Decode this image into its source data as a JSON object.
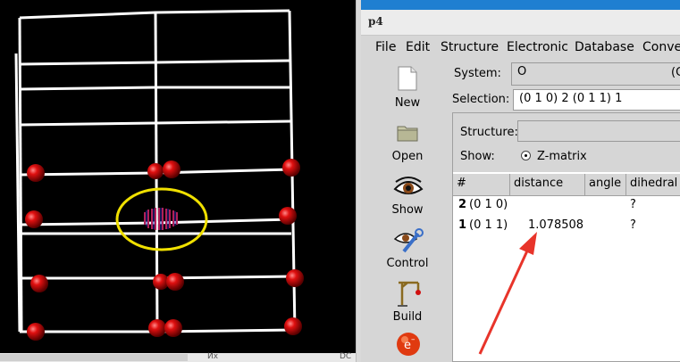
{
  "app": {
    "title_icon": "p4",
    "menus": [
      "File",
      "Edit",
      "Structure",
      "Electronic",
      "Database",
      "Conve"
    ]
  },
  "toolbar": {
    "items": [
      {
        "label": "New",
        "icon": "new-document-icon"
      },
      {
        "label": "Open",
        "icon": "folder-icon"
      },
      {
        "label": "Show",
        "icon": "eye-icon"
      },
      {
        "label": "Control",
        "icon": "wrench-eye-icon"
      },
      {
        "label": "Build",
        "icon": "crane-icon"
      },
      {
        "label": "",
        "icon": "electron-icon",
        "glyph": "e"
      }
    ]
  },
  "main": {
    "system_label": "System:",
    "system_value": "O",
    "system_suffix": "(C",
    "selection_label": "Selection:",
    "selection_value": "(0 1 0) 2  (0 1 1) 1",
    "structure_label": "Structure:",
    "structure_value": "",
    "show_label": "Show:",
    "show_option": "Z-matrix",
    "table": {
      "headers": [
        "#",
        "distance",
        "angle",
        "dihedral"
      ],
      "rows": [
        {
          "index": "2",
          "coords": "(0 1 0)",
          "distance": "",
          "angle": "",
          "dihedral": "?"
        },
        {
          "index": "1",
          "coords": "(0 1 1)",
          "distance": "1.078508",
          "angle": "",
          "dihedral": "?"
        }
      ]
    }
  },
  "bottom_strip": {
    "text1": "Их",
    "text2": "DC"
  },
  "colors": {
    "atom": "#d40000",
    "selection_ring": "#f0e000",
    "annotation_arrow": "#e8342a",
    "titlebar_blue": "#1f7fd1"
  }
}
